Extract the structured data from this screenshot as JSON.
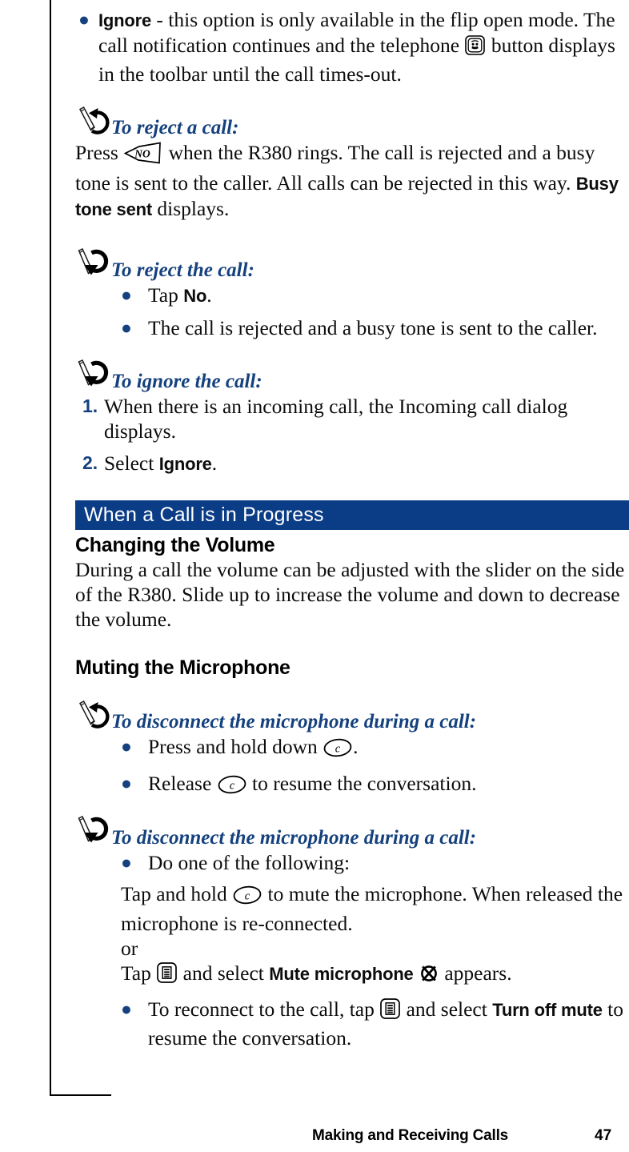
{
  "page": {
    "footer_title": "Making and Receiving Calls",
    "footer_page_number": "47",
    "accent_blue": "#15417e",
    "band_blue": "#0b3d87"
  },
  "blocks": {
    "ignore_bullet": {
      "term": "Ignore",
      "text_before_icon": " - this option is only available in the flip open mode. The call notification continues and the telephone ",
      "icon": "telephone-button-icon",
      "text_after_icon": " button displays in the toolbar until the call times-out."
    },
    "reject_a_call": {
      "icon": "stylus-undo-icon",
      "heading": "To reject a call:",
      "text_before_key": "Press ",
      "key": "no-key-icon",
      "key_label": "NO",
      "text_after_key": " when the R380 rings. The call is rejected and a busy tone is sent to the caller. All calls can be rejected in this way. ",
      "status_term": "Busy tone sent",
      "text_end": " displays."
    },
    "reject_the_call": {
      "icon": "flip-closed-icon",
      "heading": "To reject the call:",
      "items": [
        {
          "prefix": "Tap ",
          "term": "No",
          "suffix": "."
        },
        {
          "prefix": "The call is rejected and a busy tone is sent to the caller.",
          "term": "",
          "suffix": ""
        }
      ]
    },
    "ignore_the_call": {
      "icon": "flip-closed-icon",
      "heading": "To ignore the call:",
      "steps": [
        {
          "number": "1.",
          "prefix": "When there is an incoming call, the Incoming call dialog displays.",
          "term": "",
          "suffix": ""
        },
        {
          "number": "2.",
          "prefix": "Select ",
          "term": "Ignore",
          "suffix": "."
        }
      ]
    },
    "section_band": {
      "title": "When a Call is in Progress"
    },
    "changing_volume": {
      "heading": "Changing the Volume",
      "text": "During a call the volume can be adjusted with the slider on the side of the R380. Slide up to increase the volume and down to decrease the volume."
    },
    "muting_microphone": {
      "heading": "Muting the Microphone"
    },
    "disconnect_mic_flip_open": {
      "icon": "stylus-undo-icon",
      "heading": "To disconnect the microphone during a call:",
      "items": [
        {
          "prefix": "Press and hold down ",
          "key": "c-key-icon",
          "suffix": "."
        },
        {
          "prefix": "Release ",
          "key": "c-key-icon",
          "suffix": " to resume the conversation."
        }
      ]
    },
    "disconnect_mic_flip_closed": {
      "icon": "flip-closed-icon",
      "heading": "To disconnect the microphone during a call:",
      "lead_bullet": "Do one of the following:",
      "para_1_prefix": "Tap and hold ",
      "para_1_key": "c-key-icon",
      "para_1_suffix": " to mute the microphone. When released the microphone is re-connected.",
      "or_word": "or",
      "para_2_prefix": "Tap ",
      "para_2_key": "menu-button-icon",
      "para_2_mid": " and select ",
      "para_2_term": "Mute microphone",
      "para_2_icon": "mute-crossed-circle-icon",
      "para_2_suffix": " appears.",
      "reconnect_prefix": "To reconnect to the call, tap ",
      "reconnect_key": "menu-button-icon",
      "reconnect_mid": " and select ",
      "reconnect_term": "Turn off mute",
      "reconnect_suffix": " to resume the conversation."
    }
  }
}
